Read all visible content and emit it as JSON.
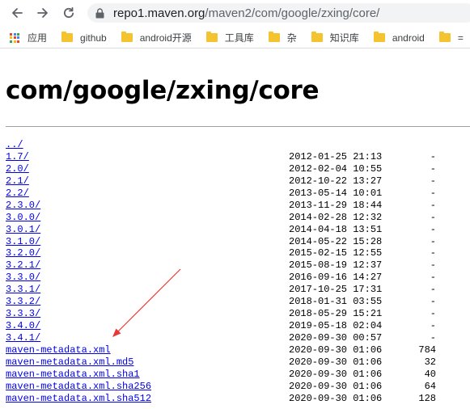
{
  "browser": {
    "url_host": "repo1.maven.org",
    "url_path": "/maven2/com/google/zxing/core/"
  },
  "bookmarks": [
    {
      "label": "应用",
      "icon": "apps-icon"
    },
    {
      "label": "github",
      "icon": "folder-icon"
    },
    {
      "label": "android开源",
      "icon": "folder-icon"
    },
    {
      "label": "工具库",
      "icon": "folder-icon"
    },
    {
      "label": "杂",
      "icon": "folder-icon"
    },
    {
      "label": "知识库",
      "icon": "folder-icon"
    },
    {
      "label": "android",
      "icon": "folder-icon"
    },
    {
      "label": "=",
      "icon": "folder-icon"
    }
  ],
  "page": {
    "title": "com/google/zxing/core",
    "entries": [
      {
        "name": "../",
        "date": "",
        "size": ""
      },
      {
        "name": "1.7/",
        "date": "2012-01-25 21:13",
        "size": "-"
      },
      {
        "name": "2.0/",
        "date": "2012-02-04 10:55",
        "size": "-"
      },
      {
        "name": "2.1/",
        "date": "2012-10-22 13:27",
        "size": "-"
      },
      {
        "name": "2.2/",
        "date": "2013-05-14 10:01",
        "size": "-"
      },
      {
        "name": "2.3.0/",
        "date": "2013-11-29 18:44",
        "size": "-"
      },
      {
        "name": "3.0.0/",
        "date": "2014-02-28 12:32",
        "size": "-"
      },
      {
        "name": "3.0.1/",
        "date": "2014-04-18 13:51",
        "size": "-"
      },
      {
        "name": "3.1.0/",
        "date": "2014-05-22 15:28",
        "size": "-"
      },
      {
        "name": "3.2.0/",
        "date": "2015-02-15 12:55",
        "size": "-"
      },
      {
        "name": "3.2.1/",
        "date": "2015-08-19 12:37",
        "size": "-"
      },
      {
        "name": "3.3.0/",
        "date": "2016-09-16 14:27",
        "size": "-"
      },
      {
        "name": "3.3.1/",
        "date": "2017-10-25 17:31",
        "size": "-"
      },
      {
        "name": "3.3.2/",
        "date": "2018-01-31 03:55",
        "size": "-"
      },
      {
        "name": "3.3.3/",
        "date": "2018-05-29 15:21",
        "size": "-"
      },
      {
        "name": "3.4.0/",
        "date": "2019-05-18 02:04",
        "size": "-"
      },
      {
        "name": "3.4.1/",
        "date": "2020-09-30 00:57",
        "size": "-"
      },
      {
        "name": "maven-metadata.xml",
        "date": "2020-09-30 01:06",
        "size": "784"
      },
      {
        "name": "maven-metadata.xml.md5",
        "date": "2020-09-30 01:06",
        "size": "32"
      },
      {
        "name": "maven-metadata.xml.sha1",
        "date": "2020-09-30 01:06",
        "size": "40"
      },
      {
        "name": "maven-metadata.xml.sha256",
        "date": "2020-09-30 01:06",
        "size": "64"
      },
      {
        "name": "maven-metadata.xml.sha512",
        "date": "2020-09-30 01:06",
        "size": "128"
      }
    ]
  },
  "colors": {
    "link": "#0000ee",
    "annotation_arrow": "#e53935",
    "folder": "#f4c430"
  }
}
